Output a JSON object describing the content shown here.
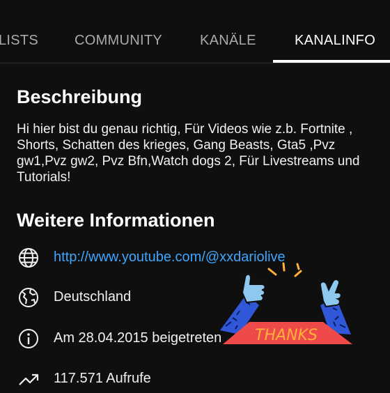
{
  "tabs": [
    {
      "label": "LISTS"
    },
    {
      "label": "COMMUNITY"
    },
    {
      "label": "KANÄLE"
    },
    {
      "label": "KANALINFO",
      "active": true
    }
  ],
  "description": {
    "heading": "Beschreibung",
    "text": "Hi hier bist du genau richtig,  Für Videos wie  z.b. Fortnite , Shorts, Schatten des krieges, Gang Beasts, Gta5 ,Pvz gw1,Pvz gw2, Pvz Bfn,Watch dogs 2, Für Livestreams und Tutorials!"
  },
  "more_info": {
    "heading": "Weitere Informationen",
    "items": [
      {
        "icon": "globe-icon",
        "text": "http://www.youtube.com/@xxdariolive"
      },
      {
        "icon": "earth-location-icon",
        "text": "Deutschland"
      },
      {
        "icon": "info-circle-icon",
        "text": "Am 28.04.2015 beigetreten"
      },
      {
        "icon": "trending-views-icon",
        "text": "117.571 Aufrufe"
      }
    ]
  },
  "sticker": {
    "text": "THANKS",
    "icon": "thumbs-up-thanks-sticker-icon"
  },
  "colors": {
    "background": "#0f0f0f",
    "link": "#3ea6ff",
    "muted_tab": "#aaaaaa",
    "sticker_blue": "#2f57d8",
    "sticker_red": "#ef4a4a",
    "sticker_yellow": "#ffb13b"
  }
}
